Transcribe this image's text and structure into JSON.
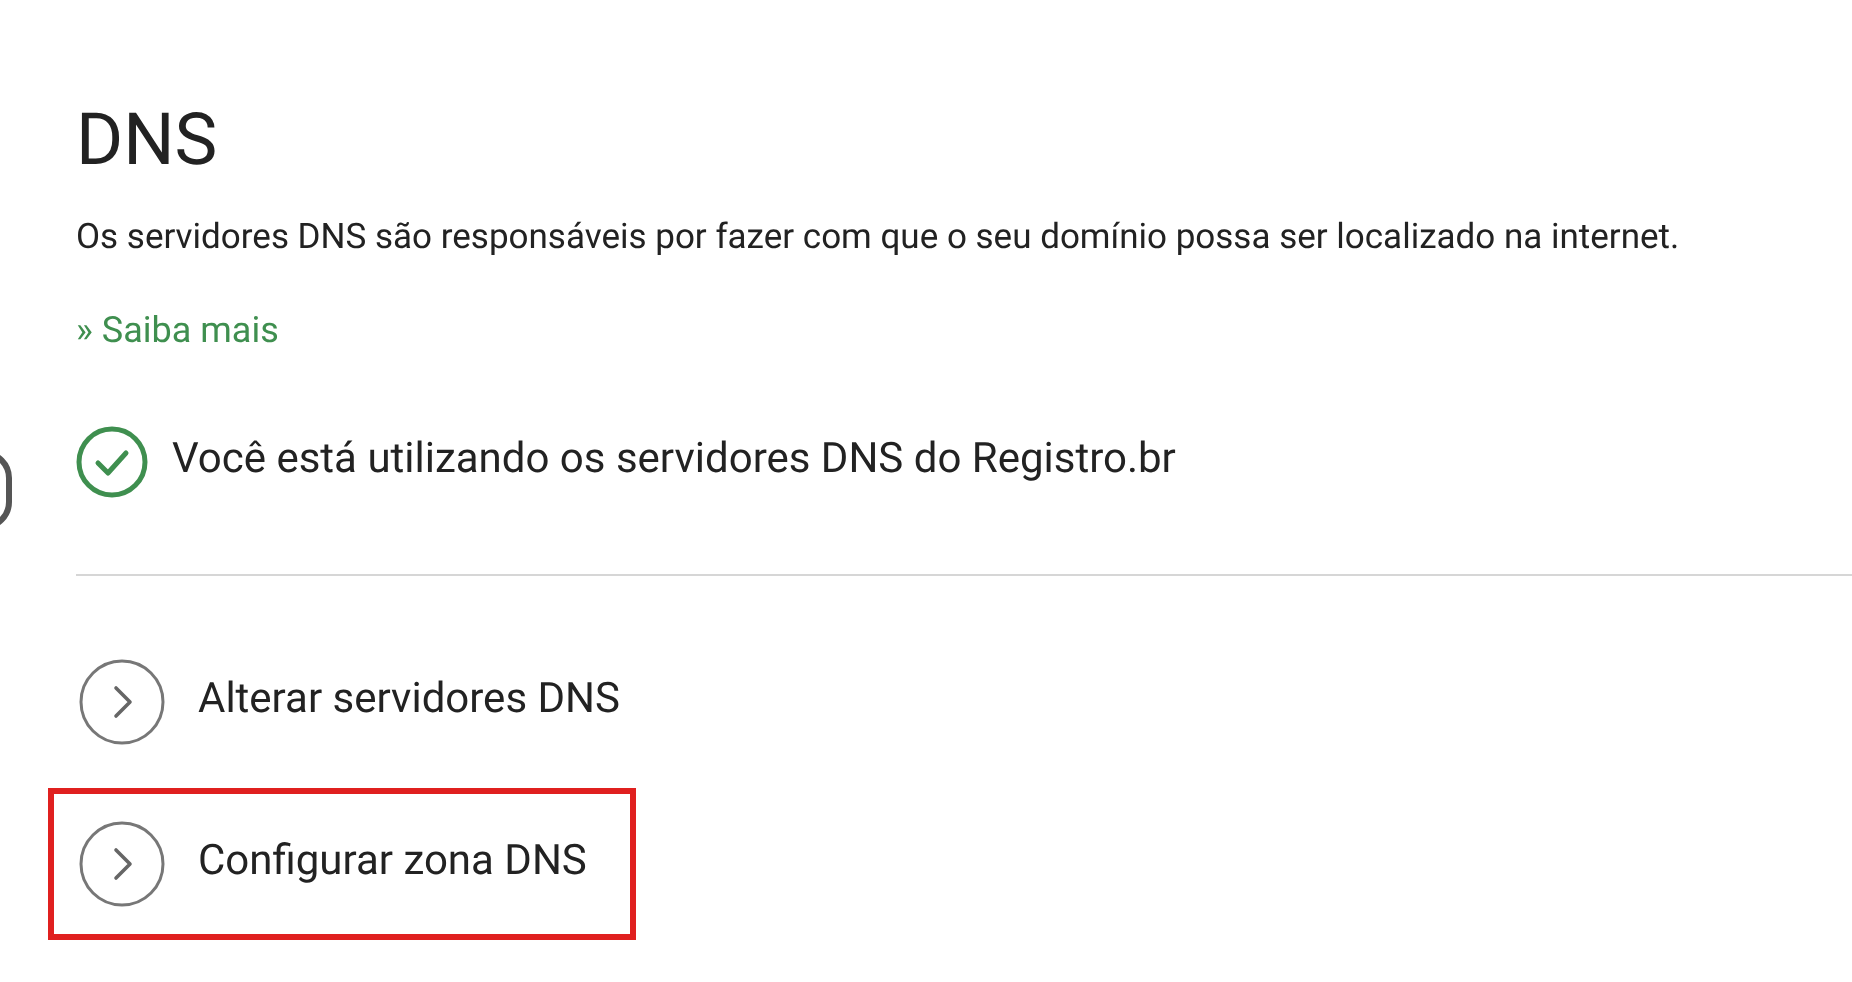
{
  "title": "DNS",
  "description": "Os servidores DNS são responsáveis por fazer com que o seu domínio possa ser localizado na internet.",
  "more_link": "» Saiba mais",
  "status": {
    "text": "Você está utilizando os servidores DNS do Registro.br",
    "ok": true
  },
  "actions": [
    {
      "label": "Alterar servidores DNS",
      "highlighted": false
    },
    {
      "label": "Configurar zona DNS",
      "highlighted": true
    }
  ]
}
